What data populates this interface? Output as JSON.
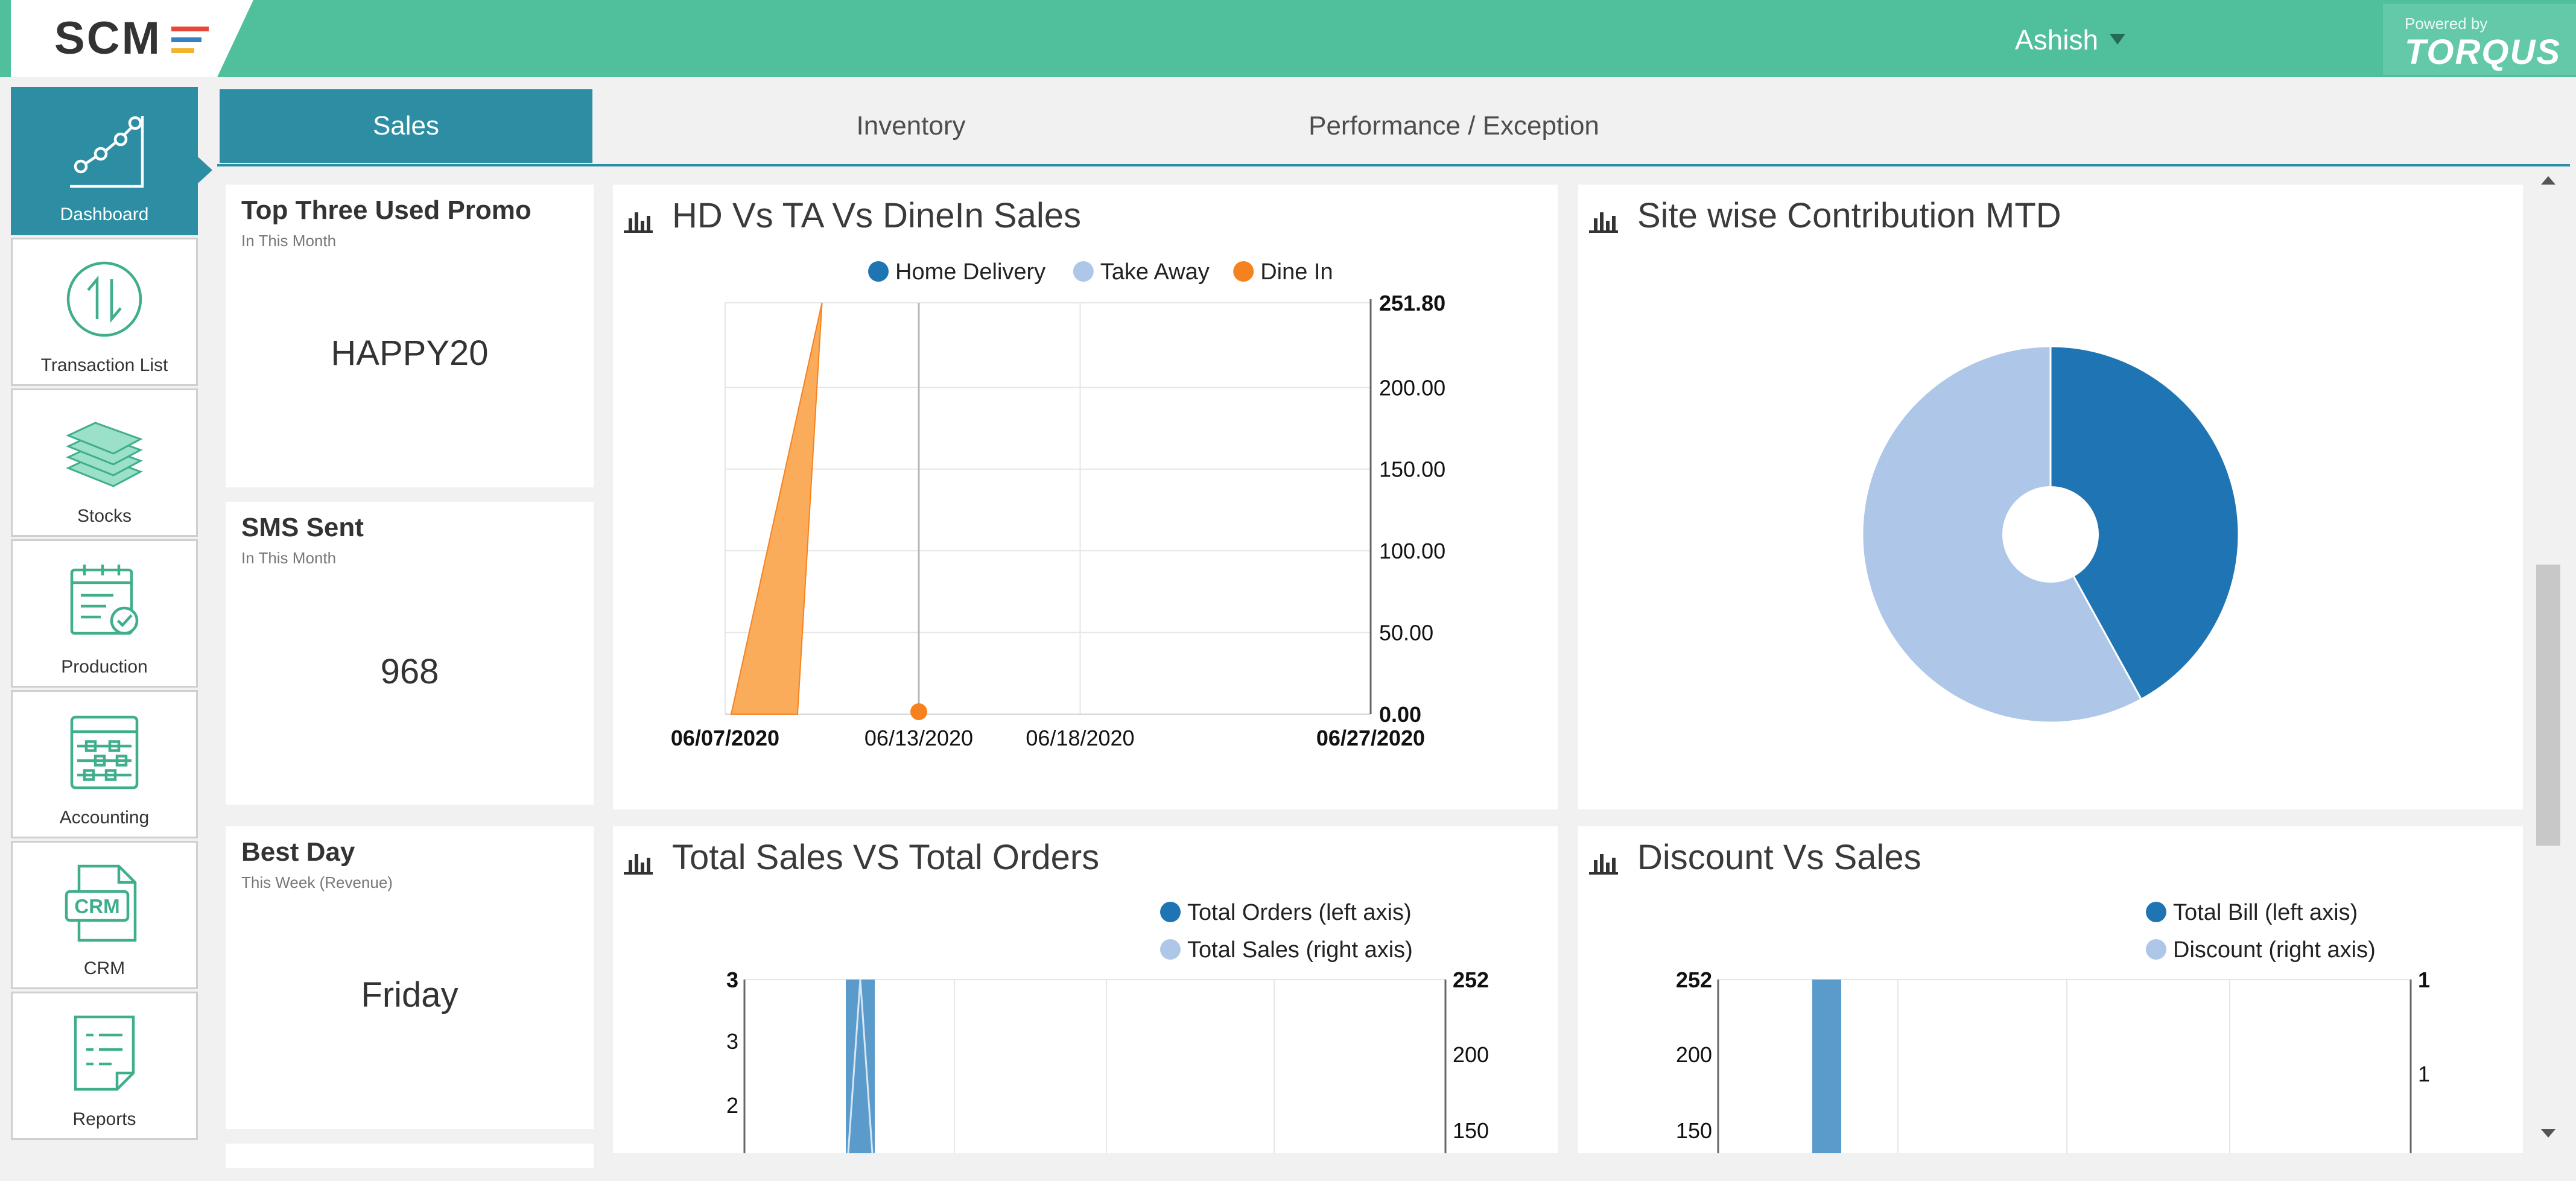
{
  "header": {
    "logo_text": "SCM",
    "user_name": "Ashish",
    "powered_by_label": "Powered by",
    "powered_by_brand": "TORQUS"
  },
  "sidebar": {
    "items": [
      {
        "label": "Dashboard",
        "icon": "dashboard-icon",
        "active": true
      },
      {
        "label": "Transaction List",
        "icon": "transaction-list-icon"
      },
      {
        "label": "Stocks",
        "icon": "stocks-icon"
      },
      {
        "label": "Production",
        "icon": "production-icon"
      },
      {
        "label": "Accounting",
        "icon": "accounting-icon"
      },
      {
        "label": "CRM",
        "icon": "crm-icon"
      },
      {
        "label": "Reports",
        "icon": "reports-icon"
      }
    ]
  },
  "tabs": [
    {
      "label": "Sales",
      "active": true
    },
    {
      "label": "Inventory"
    },
    {
      "label": "Performance / Exception"
    }
  ],
  "stats": [
    {
      "title": "Top Three Used Promo",
      "subtitle": "In This Month",
      "value": "HAPPY20"
    },
    {
      "title": "SMS Sent",
      "subtitle": "In This Month",
      "value": "968"
    },
    {
      "title": "Best Day",
      "subtitle": "This Week (Revenue)",
      "value": "Friday"
    }
  ],
  "colors": {
    "header": "#4fbf9c",
    "accent": "#2c8da3",
    "home_delivery": "#1f74b3",
    "take_away": "#aec7e8",
    "dine_in": "#f5821f",
    "dine_in_fill": "#fbac5a",
    "bar_fill": "#5b9bcb"
  },
  "chart_data": [
    {
      "type": "area",
      "title": "HD Vs TA Vs DineIn Sales",
      "x": [
        "06/07/2020",
        "06/10/2020",
        "06/13/2020"
      ],
      "x_ticks": [
        "06/07/2020",
        "06/13/2020",
        "06/18/2020",
        "06/27/2020"
      ],
      "y_ticks": [
        "0.00",
        "50.00",
        "100.00",
        "150.00",
        "200.00",
        "251.80"
      ],
      "ylim": [
        0,
        251.8
      ],
      "y_axis_side": "right",
      "legend": "top",
      "grid": true,
      "series": [
        {
          "name": "Home Delivery",
          "values": [
            0,
            0,
            0
          ]
        },
        {
          "name": "Take Away",
          "values": [
            0,
            0,
            0
          ]
        },
        {
          "name": "Dine In",
          "values": [
            0,
            251.8,
            0
          ]
        }
      ]
    },
    {
      "type": "pie",
      "title": "Site wise Contribution MTD",
      "donut": true,
      "slices": [
        {
          "value": 42,
          "color": "#1f74b3"
        },
        {
          "value": 58,
          "color": "#aec7e8"
        }
      ]
    },
    {
      "type": "bar",
      "title": "Total Sales VS Total Orders",
      "legend": "top-right",
      "grid": true,
      "left_axis": {
        "ticks": [
          "2",
          "3",
          "3"
        ],
        "ylim": [
          1.6,
          3
        ]
      },
      "right_axis": {
        "ticks": [
          "150",
          "200",
          "252"
        ],
        "ylim": [
          140,
          252
        ]
      },
      "series": [
        {
          "name": "Total Orders (left axis)"
        },
        {
          "name": "Total Sales (right axis)"
        }
      ]
    },
    {
      "type": "bar",
      "title": "Discount Vs Sales",
      "legend": "top-right",
      "grid": true,
      "left_axis": {
        "ticks": [
          "150",
          "200",
          "252"
        ],
        "ylim": [
          140,
          252
        ]
      },
      "right_axis": {
        "ticks": [
          "1",
          "1"
        ]
      },
      "series": [
        {
          "name": "Total Bill (left axis)"
        },
        {
          "name": "Discount (right axis)"
        }
      ]
    }
  ]
}
